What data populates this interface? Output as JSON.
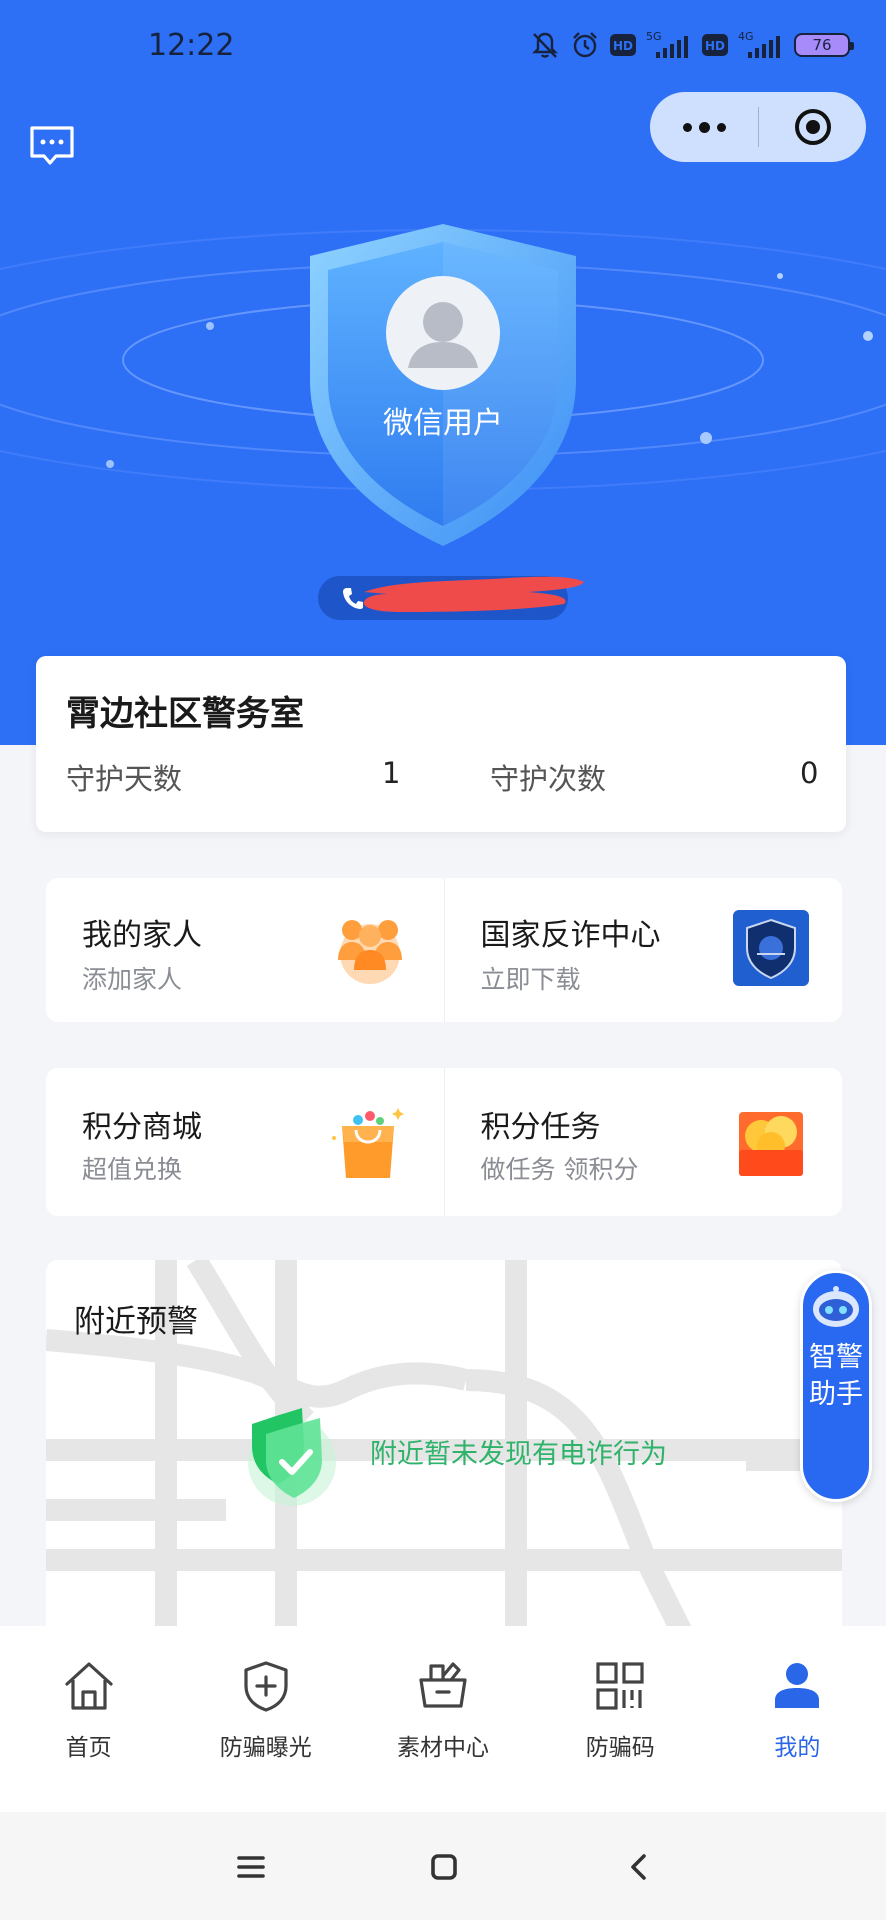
{
  "status_bar": {
    "time": "12:22",
    "network_1": "5G",
    "network_2": "4G",
    "hd_badge": "HD",
    "battery": "76"
  },
  "top_bar": {
    "message_icon": "message-icon",
    "more_icon": "more-dots-icon",
    "close_icon": "target-close-icon"
  },
  "profile": {
    "username": "微信用户",
    "avatar_icon": "default-avatar-icon",
    "phone_icon": "phone-icon"
  },
  "station": {
    "name": "霄边社区警务室",
    "guard_days_label": "守护天数",
    "guard_days_value": "1",
    "guard_times_label": "守护次数",
    "guard_times_value": "0"
  },
  "grid_row_1": [
    {
      "title": "我的家人",
      "subtitle": "添加家人",
      "icon": "family-icon"
    },
    {
      "title": "国家反诈中心",
      "subtitle": "立即下载",
      "icon": "anti-fraud-app-icon"
    }
  ],
  "grid_row_2": [
    {
      "title": "积分商城",
      "subtitle": "超值兑换",
      "icon": "shopping-bag-icon"
    },
    {
      "title": "积分任务",
      "subtitle": "做任务 领积分",
      "icon": "coin-chest-icon"
    }
  ],
  "nearby": {
    "title": "附近预警",
    "status_text": "附近暂未发现有电诈行为",
    "status_icon": "safe-shield-check-icon"
  },
  "assistant": {
    "label": "智警助手",
    "icon": "robot-icon"
  },
  "tabbar": {
    "items": [
      {
        "label": "首页",
        "icon": "home-icon"
      },
      {
        "label": "防骗曝光",
        "icon": "shield-plus-icon"
      },
      {
        "label": "素材中心",
        "icon": "basket-icon"
      },
      {
        "label": "防骗码",
        "icon": "qr-code-icon"
      },
      {
        "label": "我的",
        "icon": "user-icon"
      }
    ],
    "active_index": 4,
    "active_color": "#2a66e8"
  },
  "colors": {
    "hero_blue": "#2d6ff5",
    "safe_green": "#2fb36a"
  }
}
